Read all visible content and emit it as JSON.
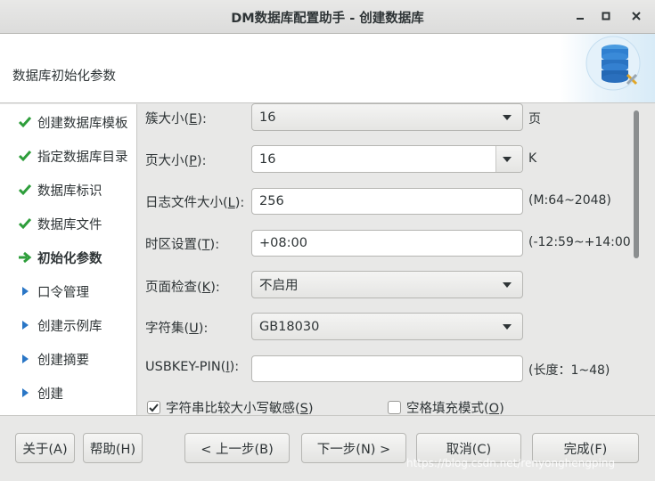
{
  "window": {
    "title": "DM数据库配置助手 - 创建数据库"
  },
  "header": {
    "subtitle": "数据库初始化参数"
  },
  "sidebar": {
    "steps": [
      {
        "label": "创建数据库模板",
        "state": "done"
      },
      {
        "label": "指定数据库目录",
        "state": "done"
      },
      {
        "label": "数据库标识",
        "state": "done"
      },
      {
        "label": "数据库文件",
        "state": "done"
      },
      {
        "label": "初始化参数",
        "state": "current"
      },
      {
        "label": "口令管理",
        "state": "pending"
      },
      {
        "label": "创建示例库",
        "state": "pending"
      },
      {
        "label": "创建摘要",
        "state": "pending"
      },
      {
        "label": "创建",
        "state": "pending"
      }
    ]
  },
  "form": {
    "extent_size": {
      "label_pre": "簇大小(",
      "mnemonic": "E",
      "label_post": "):",
      "value": "16",
      "unit": "页"
    },
    "page_size": {
      "label_pre": "页大小(",
      "mnemonic": "P",
      "label_post": "):",
      "value": "16",
      "unit": "K"
    },
    "log_size": {
      "label_pre": "日志文件大小(",
      "mnemonic": "L",
      "label_post": "):",
      "value": "256",
      "hint": "(M:64~2048)"
    },
    "time_zone": {
      "label_pre": "时区设置(",
      "mnemonic": "T",
      "label_post": "):",
      "value": "+08:00",
      "hint": "(-12:59~+14:00)"
    },
    "page_check": {
      "label_pre": "页面检查(",
      "mnemonic": "K",
      "label_post": "):",
      "value": "不启用"
    },
    "charset": {
      "label_pre": "字符集(",
      "mnemonic": "U",
      "label_post": "):",
      "value": "GB18030"
    },
    "usbkey_pin": {
      "label_pre": "USBKEY-PIN(",
      "mnemonic": "I",
      "label_post": "):",
      "value": "",
      "hint": "(长度：1~48)"
    },
    "case_sensitive": {
      "label_pre": "字符串比较大小写敏感(",
      "mnemonic": "S",
      "label_post": ")",
      "checked": true
    },
    "blank_pad": {
      "label_pre": "空格填充模式(",
      "mnemonic": "O",
      "label_post": ")",
      "checked": false
    }
  },
  "footer": {
    "about": "关于(A)",
    "help": "帮助(H)",
    "prev": "< 上一步(B)",
    "next": "下一步(N) >",
    "cancel": "取消(C)",
    "finish": "完成(F)"
  },
  "watermark": "https://blog.csdn.net/renyonghengping",
  "colors": {
    "check_green": "#2e9e3b",
    "arrow_blue": "#2a76c6",
    "current_arrow_green": "#2e9e3b"
  }
}
